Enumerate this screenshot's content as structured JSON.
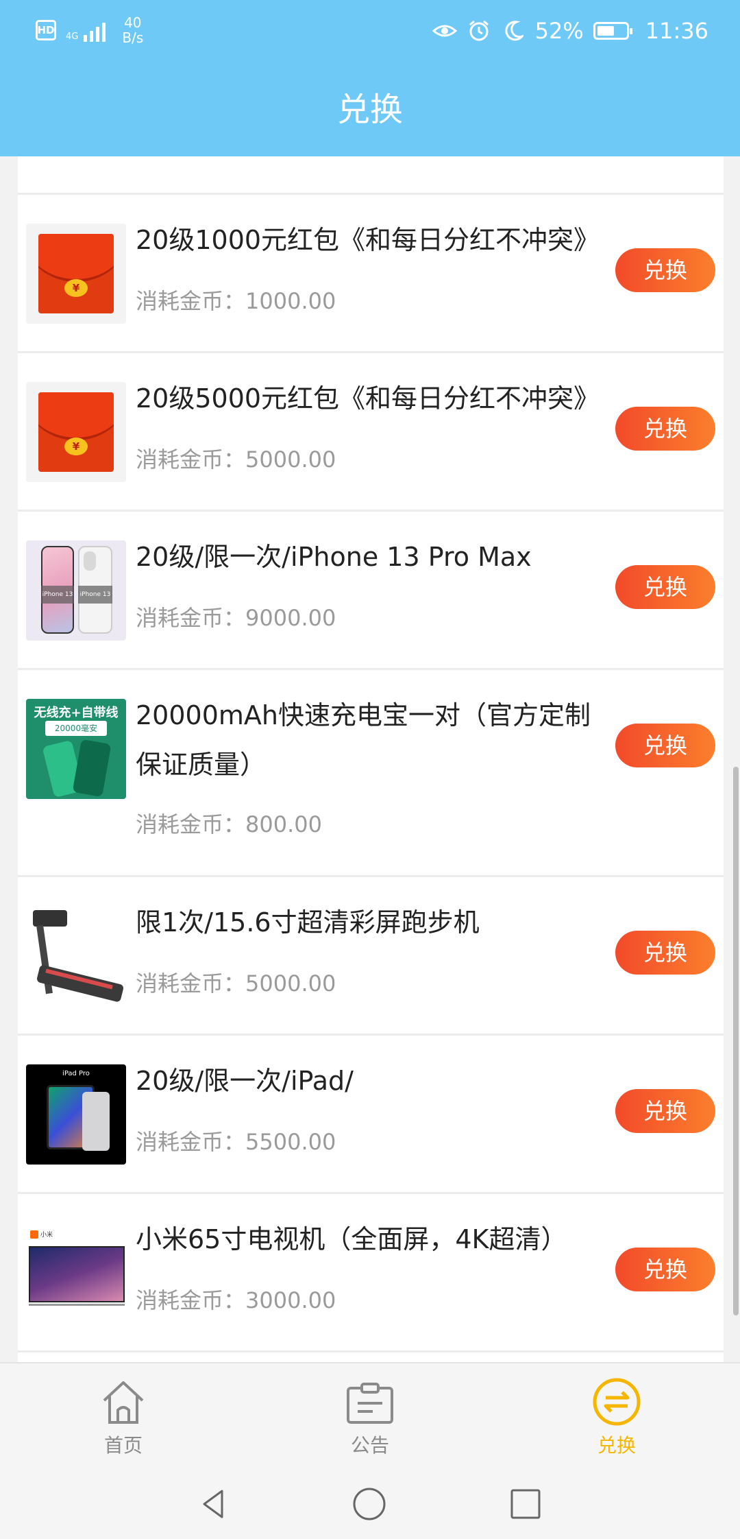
{
  "status_bar": {
    "hd": "HD",
    "network": "4G",
    "speed_value": "40",
    "speed_unit": "B/s",
    "battery": "52%",
    "time": "11:36"
  },
  "header": {
    "title": "兑换"
  },
  "items": [
    {
      "name": "20级1000元红包《和每日分红不冲突》",
      "cost_label": "消耗金币：",
      "cost": "1000.00",
      "button": "兑换",
      "thumb": "red-envelope"
    },
    {
      "name": "20级5000元红包《和每日分红不冲突》",
      "cost_label": "消耗金币：",
      "cost": "5000.00",
      "button": "兑换",
      "thumb": "red-envelope"
    },
    {
      "name": "20级/限一次/iPhone 13 Pro Max",
      "cost_label": "消耗金币：",
      "cost": "9000.00",
      "button": "兑换",
      "thumb": "iphone"
    },
    {
      "name": "20000mAh快速充电宝一对（官方定制保证质量）",
      "cost_label": "消耗金币：",
      "cost": "800.00",
      "button": "兑换",
      "thumb": "power-bank"
    },
    {
      "name": "限1次/15.6寸超清彩屏跑步机",
      "cost_label": "消耗金币：",
      "cost": "5000.00",
      "button": "兑换",
      "thumb": "treadmill"
    },
    {
      "name": "20级/限一次/iPad/",
      "cost_label": "消耗金币：",
      "cost": "5500.00",
      "button": "兑换",
      "thumb": "ipad"
    },
    {
      "name": "小米65寸电视机（全面屏，4K超清）",
      "cost_label": "消耗金币：",
      "cost": "3000.00",
      "button": "兑换",
      "thumb": "tv"
    }
  ],
  "thumb_text": {
    "envelope_symbol": "¥",
    "phone_tag_1": "iPhone 13",
    "phone_tag_2": "iPhone 13",
    "bank_title": "无线充+自带线",
    "bank_sub": "20000毫安",
    "ipad_label": "iPad Pro",
    "tv_brand": "小米"
  },
  "bottom_nav": [
    {
      "label": "首页",
      "icon": "home-icon",
      "active": false
    },
    {
      "label": "公告",
      "icon": "notice-board-icon",
      "active": false
    },
    {
      "label": "兑换",
      "icon": "exchange-icon",
      "active": true
    }
  ],
  "colors": {
    "header": "#6ec9f7",
    "button_start": "#f24a2a",
    "button_end": "#fb7f2d",
    "active_tab": "#f6b600"
  }
}
